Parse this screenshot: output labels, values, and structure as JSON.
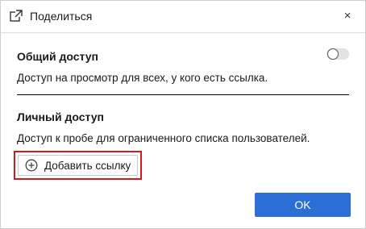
{
  "dialog": {
    "title": "Поделиться",
    "title_icon": "external-share-icon",
    "close_label": "×"
  },
  "public_access": {
    "title": "Общий доступ",
    "description": "Доступ на просмотр для всех, у кого есть ссылка.",
    "toggle_on": false
  },
  "private_access": {
    "title": "Личный доступ",
    "description": "Доступ к пробе для ограниченного списка пользователей.",
    "add_link_label": "Добавить ссылку",
    "add_icon": "plus-circle-icon"
  },
  "footer": {
    "ok_label": "OK"
  },
  "colors": {
    "primary": "#2b6fd6",
    "highlight": "#d11a1a"
  }
}
